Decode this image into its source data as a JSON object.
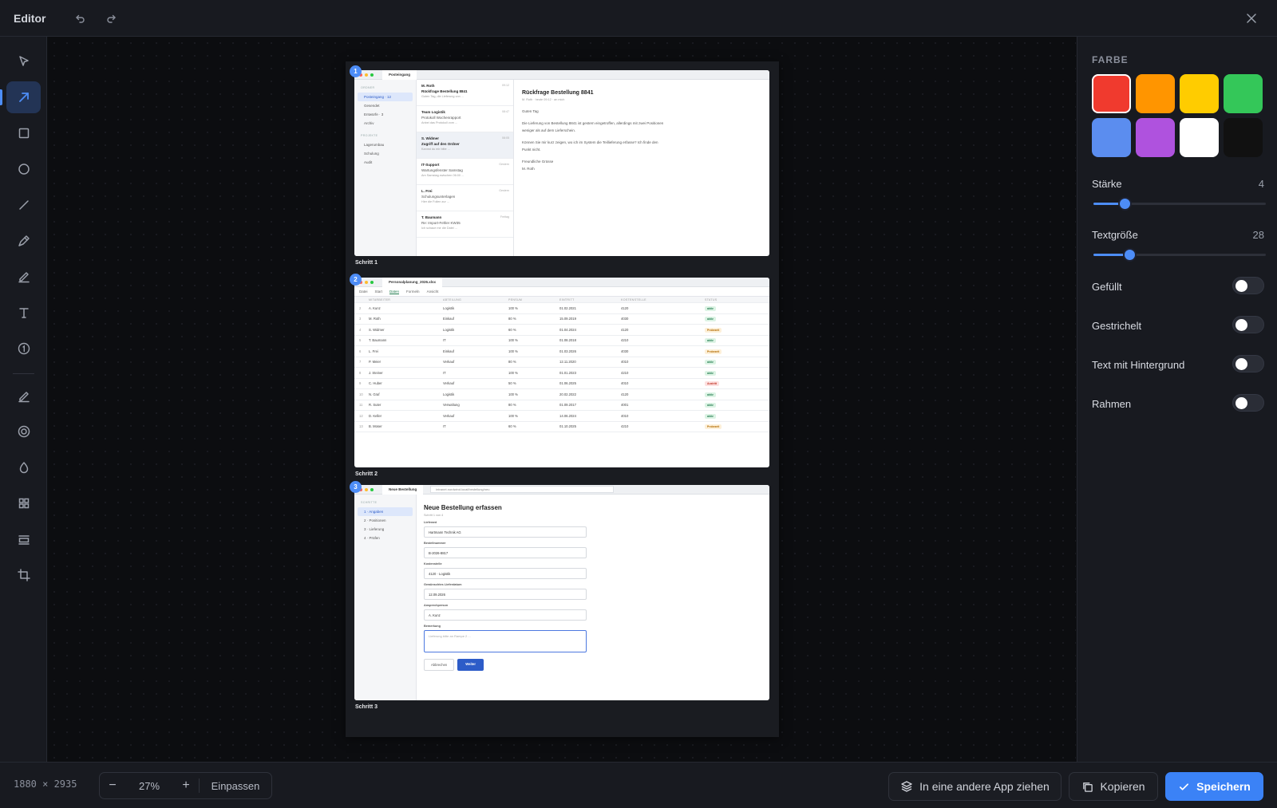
{
  "header": {
    "title": "Editor",
    "undo_icon": "undo-icon",
    "redo_icon": "redo-icon",
    "close_icon": "close-icon"
  },
  "tools": [
    {
      "name": "select",
      "icon": "cursor-icon",
      "active": false
    },
    {
      "name": "arrow",
      "icon": "arrow-icon",
      "active": true
    },
    {
      "name": "rectangle",
      "icon": "rectangle-icon",
      "active": false
    },
    {
      "name": "ellipse",
      "icon": "circle-icon",
      "active": false
    },
    {
      "name": "line",
      "icon": "line-icon",
      "active": false
    },
    {
      "name": "pen",
      "icon": "pen-icon",
      "active": false
    },
    {
      "name": "highlighter",
      "icon": "highlighter-icon",
      "active": false
    },
    {
      "name": "text",
      "icon": "text-icon",
      "active": false
    },
    {
      "name": "counter",
      "icon": "numbered-badge-icon",
      "active": false
    },
    {
      "name": "redact",
      "icon": "eraser-icon",
      "active": false
    },
    {
      "name": "spotlight",
      "icon": "spotlight-icon",
      "active": false
    },
    {
      "name": "blur",
      "icon": "drop-icon",
      "active": false
    },
    {
      "name": "layout",
      "icon": "grid-icon",
      "active": false
    },
    {
      "name": "background",
      "icon": "frame-icon",
      "active": false
    },
    {
      "name": "crop",
      "icon": "crop-icon",
      "active": false
    }
  ],
  "canvas": {
    "steps": [
      {
        "badge": "1",
        "label": "Schritt 1"
      },
      {
        "badge": "2",
        "label": "Schritt 2"
      },
      {
        "badge": "3",
        "label": "Schritt 3"
      }
    ],
    "step1": {
      "tab": "Posteingang",
      "sidebar_header": "ORDNER",
      "folders": [
        "Posteingang · 12",
        "Gesendet",
        "Entwürfe · 3",
        "Archiv"
      ],
      "projects_header": "PROJEKTE",
      "projects": [
        "Lagerumbau",
        "Schulung",
        "Audit"
      ],
      "mails": [
        {
          "from": "M. Roth",
          "time": "09:12",
          "subject": "Rückfrage Bestellung 8841",
          "preview": "Guten Tag, die Lieferung von ..."
        },
        {
          "from": "Team Logistik",
          "time": "08:47",
          "subject": "Protokoll Wochenrapport",
          "preview": "Anbei das Protokoll vom ..."
        },
        {
          "from": "S. Widmer",
          "time": "08:05",
          "subject": "Zugriff auf den Ordner",
          "preview": "Kannst du mir bitte ..."
        },
        {
          "from": "IT-Support",
          "time": "Gestern",
          "subject": "Wartungsfenster Samstag",
          "preview": "Am Samstag zwischen 06:00 ..."
        },
        {
          "from": "L. Frei",
          "time": "Gestern",
          "subject": "Schulungsunterlagen",
          "preview": "Hier die Folien zur ..."
        },
        {
          "from": "T. Baumann",
          "time": "Freitag",
          "subject": "Re: Import-Fehler KW35",
          "preview": "Ich schaue mir die Datei ..."
        }
      ],
      "read": {
        "subject": "Rückfrage Bestellung 8841",
        "meta": "M. Roth · heute 09:12 · an mich",
        "greeting": "Guten Tag",
        "p1a": "Die Lieferung von Bestellung 8841 ist gestern eingetroffen, allerdings mit zwei Positionen",
        "p1b": "weniger als auf dem Lieferschein.",
        "p2a": "Können Sie mir kurz zeigen, wo ich im System die Teillieferung erfasse? Ich finde den",
        "p2b": "Punkt nicht.",
        "closing": "Freundliche Grüsse",
        "sign": "M. Roth"
      }
    },
    "step2": {
      "tab": "Personalplanung_2026.xlsx",
      "menu": [
        "Datei",
        "Start",
        "Daten",
        "Formeln",
        "Ansicht"
      ],
      "active_menu": "Daten",
      "columns": [
        "MITARBEITER",
        "ABTEILUNG",
        "PENSUM",
        "EINTRITT",
        "KOSTENSTELLE",
        "STATUS"
      ],
      "rows": [
        [
          "2",
          "A. Kunz",
          "Logistik",
          "100 %",
          "01.02.2021",
          "4120",
          "aktiv"
        ],
        [
          "3",
          "M. Roth",
          "Einkauf",
          "80 %",
          "15.09.2019",
          "4030",
          "aktiv"
        ],
        [
          "4",
          "S. Widmer",
          "Logistik",
          "60 %",
          "01.04.2024",
          "4120",
          "Probezeit"
        ],
        [
          "5",
          "T. Baumann",
          "IT",
          "100 %",
          "01.08.2018",
          "4210",
          "aktiv"
        ],
        [
          "6",
          "L. Frei",
          "Einkauf",
          "100 %",
          "01.03.2026",
          "4030",
          "Probezeit"
        ],
        [
          "7",
          "P. Meier",
          "Verkauf",
          "80 %",
          "12.11.2020",
          "4010",
          "aktiv"
        ],
        [
          "8",
          "J. Steiner",
          "IT",
          "100 %",
          "01.01.2023",
          "4210",
          "aktiv"
        ],
        [
          "9",
          "C. Huber",
          "Verkauf",
          "50 %",
          "01.06.2025",
          "4010",
          "Austritt"
        ],
        [
          "10",
          "N. Graf",
          "Logistik",
          "100 %",
          "20.02.2022",
          "4120",
          "aktiv"
        ],
        [
          "11",
          "R. Suter",
          "Verwaltung",
          "80 %",
          "01.09.2017",
          "4001",
          "aktiv"
        ],
        [
          "12",
          "D. Keller",
          "Verkauf",
          "100 %",
          "14.06.2024",
          "4010",
          "aktiv"
        ],
        [
          "13",
          "B. Moser",
          "IT",
          "60 %",
          "01.10.2025",
          "4210",
          "Probezeit"
        ]
      ]
    },
    "step3": {
      "tab": "Neue Bestellung",
      "url": "intranet.nordwind.local/bestellung/neu",
      "sidebar_header": "SCHRITTE",
      "steps": [
        "1 · Angaben",
        "2 · Positionen",
        "3 · Lieferung",
        "4 · Prüfen"
      ],
      "title": "Neue Bestellung erfassen",
      "subtitle": "Schritt 1 von 4",
      "fields": [
        {
          "label": "Lieferant",
          "value": "Hartmann Technik AG"
        },
        {
          "label": "Bestellnummer",
          "value": "B-2026-8817"
        },
        {
          "label": "Kostenstelle",
          "value": "4120 · Logistik"
        },
        {
          "label": "Gewünschtes Lieferdatum",
          "value": "12.09.2026"
        },
        {
          "label": "Ansprechperson",
          "value": "A. Kunz"
        }
      ],
      "remark_label": "Bemerkung",
      "remark_placeholder": "Lieferung bitte an Rampe 2 ...",
      "cancel": "Abbrechen",
      "next": "Weiter"
    }
  },
  "panel": {
    "color_title": "FARBE",
    "colors": [
      "#f03a2e",
      "#ff9500",
      "#ffcc00",
      "#34c759",
      "#5b8def",
      "#af52de",
      "#ffffff",
      "#111111"
    ],
    "selected_color": "#f03a2e",
    "strength_label": "Stärke",
    "strength_value": "4",
    "strength_fraction": 0.18,
    "textsize_label": "Textgröße",
    "textsize_value": "28",
    "textsize_fraction": 0.21,
    "toggles": [
      {
        "label": "Gefüllt",
        "on": false
      },
      {
        "label": "Gestrichelt",
        "on": false
      },
      {
        "label": "Text mit Hintergrund",
        "on": false
      },
      {
        "label": "Rahmen",
        "on": false
      }
    ]
  },
  "footer": {
    "dims": "1880 × 2935",
    "zoom_minus": "−",
    "zoom": "27%",
    "zoom_plus": "+",
    "fit": "Einpassen",
    "drag_label": "In eine andere App ziehen",
    "copy_label": "Kopieren",
    "save_label": "Speichern"
  }
}
